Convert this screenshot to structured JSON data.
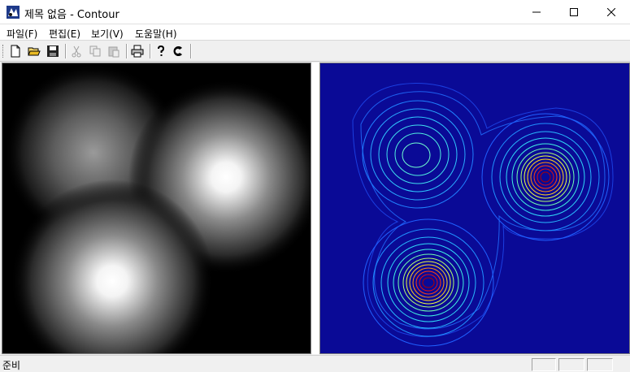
{
  "window": {
    "title": "제목 없음 - Contour",
    "app_icon": "contour-app-icon"
  },
  "controls": {
    "minimize_icon": "minimize-icon",
    "maximize_icon": "maximize-icon",
    "close_icon": "close-icon"
  },
  "menu": {
    "items": [
      {
        "label": "파일(F)"
      },
      {
        "label": "편집(E)"
      },
      {
        "label": "보기(V)"
      },
      {
        "label": "도움말(H)"
      }
    ]
  },
  "toolbar": {
    "buttons": [
      {
        "icon": "new-file-icon",
        "enabled": true
      },
      {
        "icon": "open-folder-icon",
        "enabled": true
      },
      {
        "icon": "save-icon",
        "enabled": true
      },
      {
        "icon": "cut-icon",
        "enabled": false
      },
      {
        "icon": "copy-icon",
        "enabled": false
      },
      {
        "icon": "paste-icon",
        "enabled": false
      },
      {
        "icon": "print-icon",
        "enabled": true
      },
      {
        "icon": "help-icon",
        "enabled": true
      },
      {
        "icon": "context-help-icon",
        "enabled": true
      }
    ]
  },
  "views": {
    "left": {
      "type": "grayscale-image",
      "background": "#000000"
    },
    "right": {
      "type": "contour-plot",
      "background": "#0a0a96"
    }
  },
  "status": {
    "text": "준비"
  }
}
